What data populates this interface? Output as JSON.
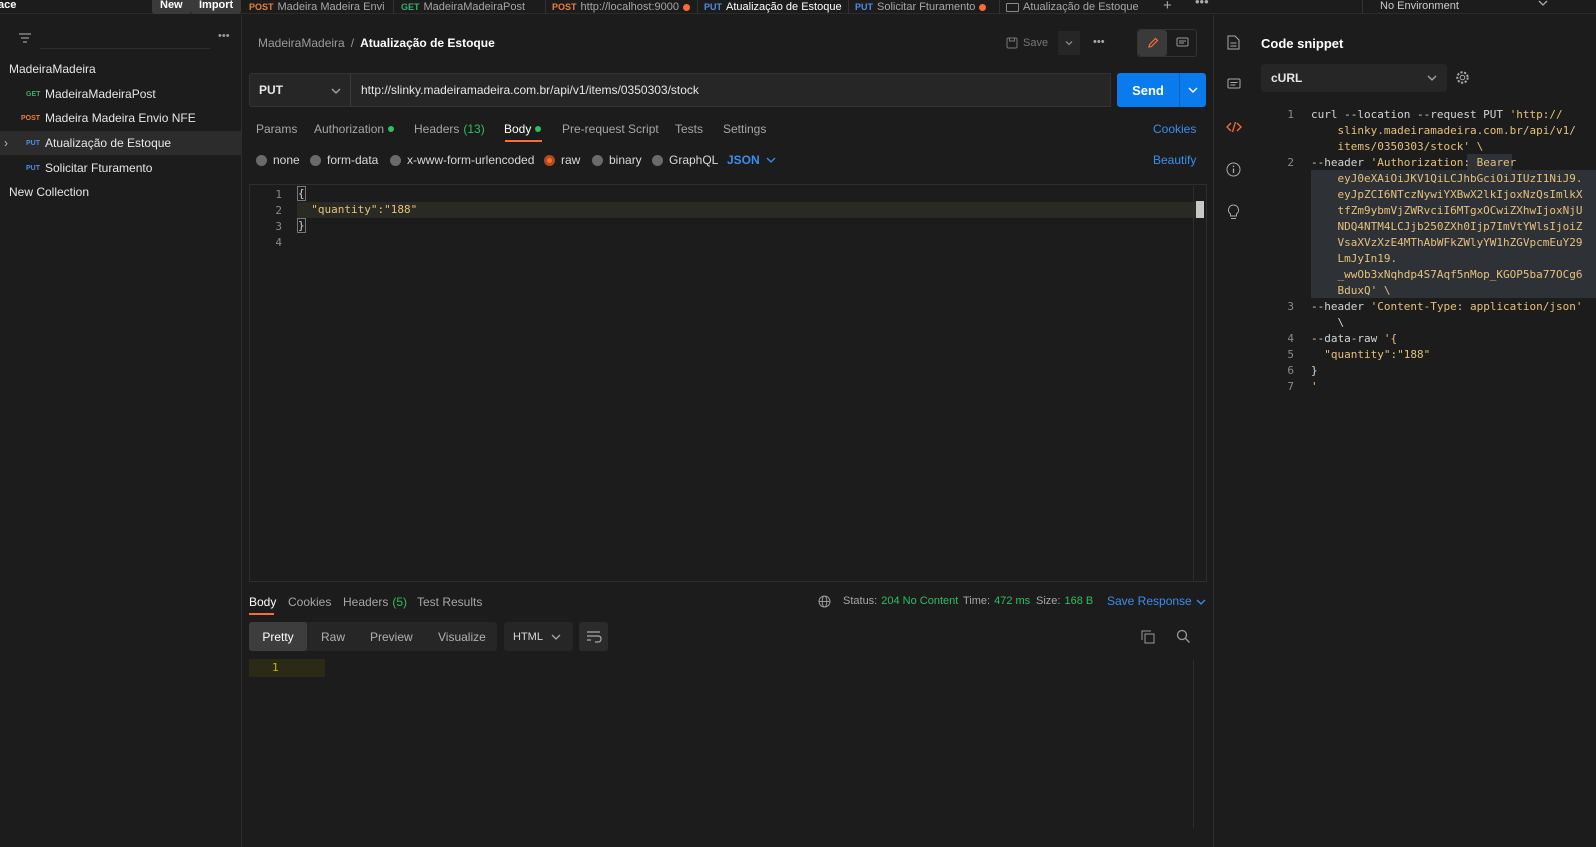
{
  "workspace": {
    "name": "ace",
    "new_label": "New",
    "import_label": "Import"
  },
  "tabs": [
    {
      "method": "POST",
      "label": "Madeira Madeira Envi",
      "dirty": true
    },
    {
      "method": "GET",
      "label": "MadeiraMadeiraPost",
      "dirty": false
    },
    {
      "method": "POST",
      "label": "http://localhost:9000",
      "dirty": true
    },
    {
      "method": "PUT",
      "label": "Atualização de Estoque",
      "dirty": false,
      "active": true
    },
    {
      "method": "PUT",
      "label": "Solicitar Fturamento",
      "dirty": true
    },
    {
      "method": "",
      "label": "Atualização de Estoque",
      "dirty": false
    }
  ],
  "environment": "No Environment",
  "sidebar": {
    "collection": "MadeiraMadeira",
    "items": [
      {
        "method": "GET",
        "label": "MadeiraMadeiraPost"
      },
      {
        "method": "POST",
        "label": "Madeira Madeira Envio NFE"
      },
      {
        "method": "PUT",
        "label": "Atualização de Estoque",
        "selected": true
      },
      {
        "method": "PUT",
        "label": "Solicitar Fturamento"
      }
    ],
    "new_collection": "New Collection"
  },
  "breadcrumb": {
    "parent": "MadeiraMadeira",
    "sep": "/",
    "current": "Atualização de Estoque"
  },
  "toolbar": {
    "save_label": "Save"
  },
  "request": {
    "method": "PUT",
    "url": "http://slinky.madeiramadeira.com.br/api/v1/items/0350303/stock",
    "send_label": "Send"
  },
  "request_tabs": {
    "params": "Params",
    "authorization": "Authorization",
    "headers": "Headers",
    "headers_count": "(13)",
    "body": "Body",
    "prerequest": "Pre-request Script",
    "tests": "Tests",
    "settings": "Settings",
    "cookies": "Cookies"
  },
  "body_types": {
    "none": "none",
    "form_data": "form-data",
    "urlencoded": "x-www-form-urlencoded",
    "raw": "raw",
    "binary": "binary",
    "graphql": "GraphQL",
    "lang": "JSON",
    "beautify": "Beautify"
  },
  "editor": {
    "line_numbers": [
      "1",
      "2",
      "3",
      "4"
    ],
    "lines": [
      "{",
      "  \"quantity\":\"188\"",
      "}",
      ""
    ]
  },
  "response": {
    "tabs": {
      "body": "Body",
      "cookies": "Cookies",
      "headers": "Headers",
      "headers_count": "(5)",
      "tests": "Test Results"
    },
    "status_label": "Status:",
    "status": "204 No Content",
    "time_label": "Time:",
    "time": "472 ms",
    "size_label": "Size:",
    "size": "168 B",
    "save_response": "Save Response",
    "views": {
      "pretty": "Pretty",
      "raw": "Raw",
      "preview": "Preview",
      "visualize": "Visualize"
    },
    "format": "HTML",
    "line_number": "1"
  },
  "snippet": {
    "title": "Code snippet",
    "language": "cURL",
    "lines": [
      {
        "n": "1",
        "text": "curl --location --request PUT 'http://"
      },
      {
        "n": "",
        "text": "    slinky.madeiramadeira.com.br/api/v1/"
      },
      {
        "n": "",
        "text": "    items/0350303/stock' \\"
      },
      {
        "n": "2",
        "text": "--header 'Authorization: Bearer"
      },
      {
        "n": "",
        "text": "    eyJ0eXAiOiJKV1QiLCJhbGciOiJIUzI1NiJ9."
      },
      {
        "n": "",
        "text": "    eyJpZCI6NTczNywiYXBwX2lkIjoxNzQsImlkX"
      },
      {
        "n": "",
        "text": "    tfZm9ybmVjZWRvciI6MTgxOCwiZXhwIjoxNjU"
      },
      {
        "n": "",
        "text": "    NDQ4NTM4LCJjb250ZXh0Ijp7ImVtYWlsIjoiZ"
      },
      {
        "n": "",
        "text": "    VsaXVzXzE4MThAbWFkZWlyYW1hZGVpcmEuY29"
      },
      {
        "n": "",
        "text": "    LmJyIn19."
      },
      {
        "n": "",
        "text": "    _wwOb3xNqhdp4S7Aqf5nMop_KGOP5ba77OCg6"
      },
      {
        "n": "",
        "text": "    BduxQ' \\"
      },
      {
        "n": "3",
        "text": "--header 'Content-Type: application/json'"
      },
      {
        "n": "",
        "text": "    \\"
      },
      {
        "n": "4",
        "text": "--data-raw '{"
      },
      {
        "n": "5",
        "text": "  \"quantity\":\"188\""
      },
      {
        "n": "6",
        "text": "}"
      },
      {
        "n": "7",
        "text": "'"
      }
    ]
  }
}
